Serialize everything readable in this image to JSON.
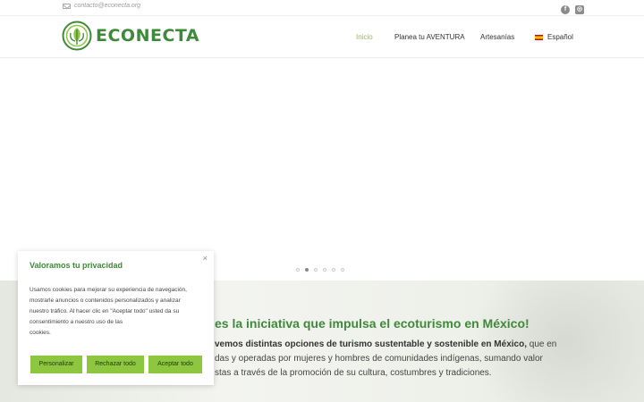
{
  "topbar": {
    "email": "contacto@econecta.org",
    "socials": [
      {
        "icon": "facebook-icon",
        "glyph": "f"
      },
      {
        "icon": "instagram-icon",
        "glyph": "◎"
      }
    ]
  },
  "header": {
    "logo_text": "ECONECTA",
    "nav": [
      "Inicio",
      "Planea tu AVENTURA",
      "Artesanías",
      "Español"
    ],
    "active_nav": "Inicio"
  },
  "slider": {
    "dot_count": 6,
    "active_dot": 2
  },
  "content": {
    "headline": "es la iniciativa que impulsa el ecoturismo en México!",
    "para_line1_bold": "vemos distintas opciones de turismo sustentable y sostenible en México,",
    "para_line1_rest": " que en",
    "para_line2": "das y operadas por mujeres y hombres de comunidades indígenas, sumando valor",
    "para_line3": "stas a través de la promoción de su cultura, costumbres y tradiciones."
  },
  "cookie": {
    "title": "Valoramos tu privacidad",
    "close": "×",
    "text_lines": [
      "Usamos cookies para mejorar su experiencia de navegación,",
      "mostrarle anuncios o contenidos personalizados y analizar",
      "nuestro tráfico. Al hacer clic en \"Aceptar todo\" usted da su",
      "consentimiento a nuestro uso de las",
      "cookies."
    ],
    "buttons": [
      "Personalizar",
      "Rechazar todo",
      "Aceptar todo"
    ]
  },
  "colors": {
    "brand_green": "#3f8a3a",
    "accent_lime": "#8dc63f"
  }
}
